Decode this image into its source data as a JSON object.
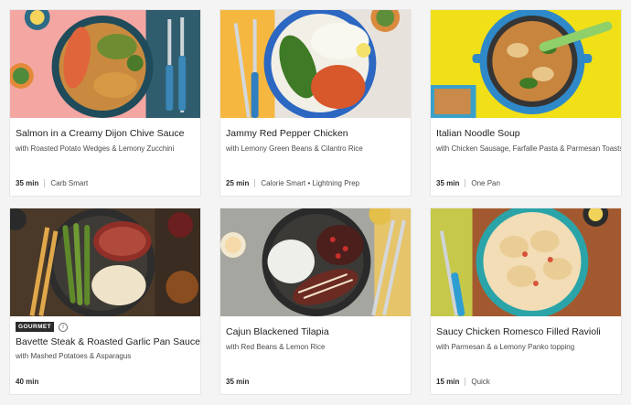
{
  "recipes": [
    {
      "title": "Salmon in a Creamy Dijon Chive Sauce",
      "subtitle": "with Roasted Potato Wedges & Lemony Zucchini",
      "time": "35 min",
      "tags": "Carb Smart",
      "image_icon": "salmon-dish-image",
      "bg_color": "#f3a5a3"
    },
    {
      "title": "Jammy Red Pepper Chicken",
      "subtitle": "with Lemony Green Beans & Cilantro Rice",
      "time": "25 min",
      "tags": "Calorie Smart • Lightning Prep",
      "image_icon": "chicken-dish-image",
      "bg_color": "#f5b946"
    },
    {
      "title": "Italian Noodle Soup",
      "subtitle": "with Chicken Sausage, Farfalle Pasta & Parmesan Toasts",
      "time": "35 min",
      "tags": "One Pan",
      "image_icon": "soup-pot-image",
      "bg_color": "#f2e116"
    },
    {
      "badge": "GOURMET",
      "info_icon": "info-icon",
      "title": "Bavette Steak & Roasted Garlic Pan Sauce",
      "subtitle": "with Mashed Potatoes & Asparagus",
      "time": "40 min",
      "tags": "",
      "image_icon": "steak-dish-image",
      "bg_color": "#4b3a2c"
    },
    {
      "title": "Cajun Blackened Tilapia",
      "subtitle": "with Red Beans & Lemon Rice",
      "time": "35 min",
      "tags": "",
      "image_icon": "tilapia-dish-image",
      "bg_color": "#a9a9a3"
    },
    {
      "title": "Saucy Chicken Romesco Filled Ravioli",
      "subtitle": "with Parmesan & a Lemony Panko topping",
      "time": "15 min",
      "tags": "Quick",
      "image_icon": "ravioli-dish-image",
      "bg_color": "#a35a34"
    }
  ]
}
